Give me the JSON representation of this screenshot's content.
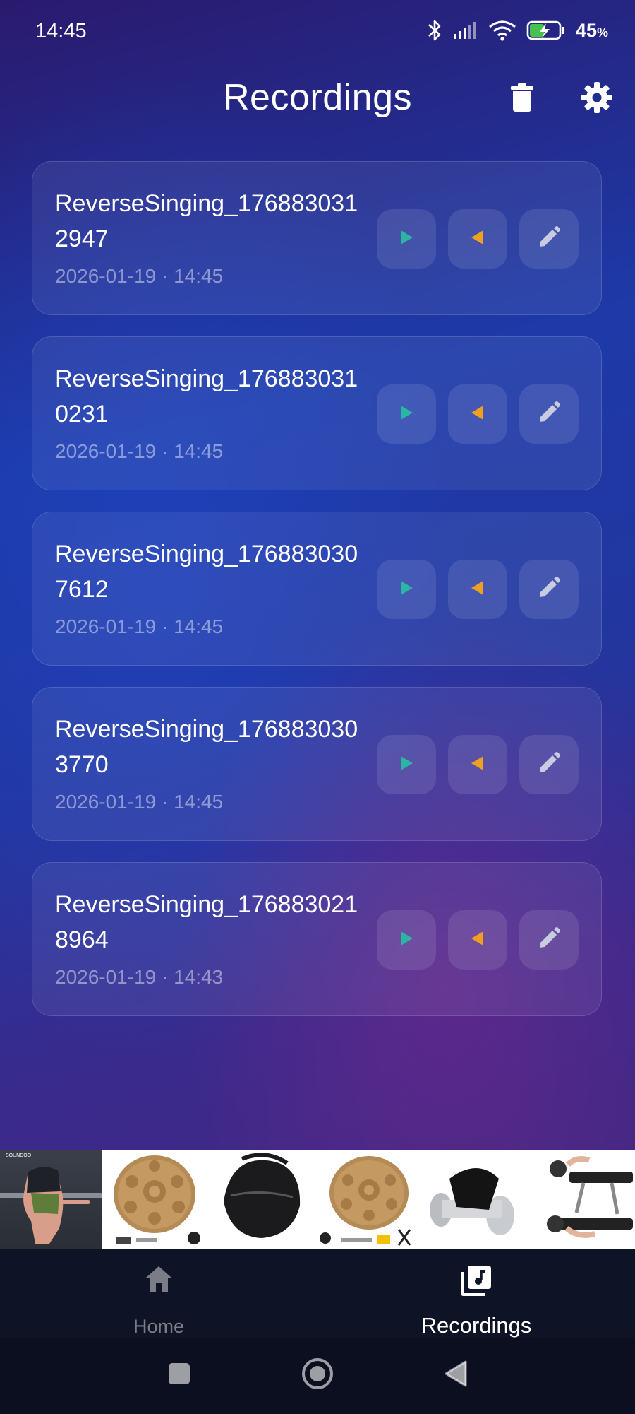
{
  "status_bar": {
    "time": "14:45",
    "battery": "45",
    "battery_unit": "%",
    "icons": [
      "bluetooth-icon",
      "signal-icon",
      "wifi-icon",
      "battery-charging-icon"
    ]
  },
  "header": {
    "title": "Recordings",
    "actions": [
      "trash-icon",
      "settings-gear-icon"
    ]
  },
  "recordings": [
    {
      "name": "ReverseSinging_1768830312947",
      "date": "2026-01-19 · 14:45"
    },
    {
      "name": "ReverseSinging_1768830310231",
      "date": "2026-01-19 · 14:45"
    },
    {
      "name": "ReverseSinging_1768830307612",
      "date": "2026-01-19 · 14:45"
    },
    {
      "name": "ReverseSinging_1768830303770",
      "date": "2026-01-19 · 14:45"
    },
    {
      "name": "ReverseSinging_1768830218964",
      "date": "2026-01-19 · 14:43"
    }
  ],
  "recording_actions": [
    "play-forward-icon",
    "play-reverse-icon",
    "edit-pencil-icon"
  ],
  "colors": {
    "play_forward": "#2bb5a3",
    "play_reverse": "#f0a020",
    "edit": "#c9cbe0",
    "nav_bg": "#0e1326"
  },
  "ad_banner": {
    "logo_text": "SOUNDOO",
    "tiles": [
      "fitness-glove",
      "handpan-drum",
      "handpan-bag",
      "handpan-drum",
      "wrist-roller",
      "bench-equipment"
    ]
  },
  "bottom_nav": {
    "items": [
      {
        "label": "Home",
        "icon": "home-icon",
        "active": false
      },
      {
        "label": "Recordings",
        "icon": "music-library-icon",
        "active": true
      }
    ]
  },
  "system_nav": [
    "recents-square-icon",
    "home-circle-icon",
    "back-triangle-icon"
  ]
}
